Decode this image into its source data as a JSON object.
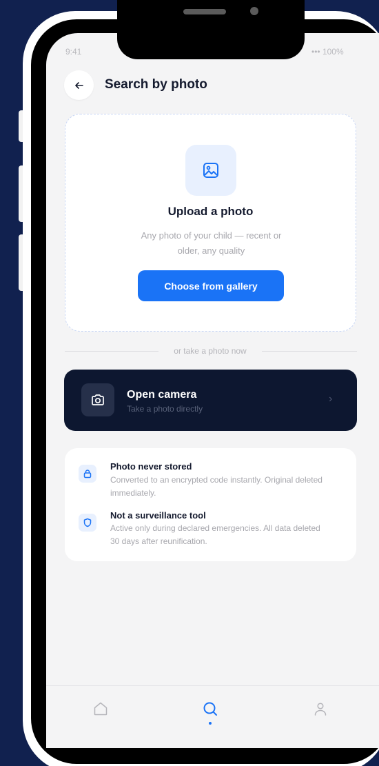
{
  "status_bar": {
    "time": "9:41",
    "battery": "••• 100%"
  },
  "header": {
    "back_icon": "arrow-left-icon",
    "title": "Search by photo"
  },
  "upload": {
    "icon": "image-icon",
    "title": "Upload a photo",
    "description": "Any photo of your child — recent or older, any quality",
    "button_label": "Choose from gallery"
  },
  "divider": {
    "text": "or take a photo now"
  },
  "camera": {
    "icon": "camera-icon",
    "title": "Open camera",
    "subtitle": "Take a photo directly",
    "chevron": "›"
  },
  "info": {
    "items": [
      {
        "icon": "lock-icon",
        "title": "Photo never stored",
        "description": "Converted to an encrypted code instantly. Original deleted immediately."
      },
      {
        "icon": "shield-icon",
        "title": "Not a surveillance tool",
        "description": "Active only during declared emergencies. All data deleted 30 days after reunification."
      }
    ]
  },
  "nav": {
    "items": [
      {
        "icon": "home-icon",
        "active": false
      },
      {
        "icon": "search-icon",
        "active": true
      },
      {
        "icon": "profile-icon",
        "active": false
      }
    ]
  },
  "colors": {
    "background": "#11214f",
    "accent": "#1a73f6",
    "dark_card": "#0d1730",
    "screen": "#f4f4f5",
    "icon_tint": "#e8f0fe"
  }
}
